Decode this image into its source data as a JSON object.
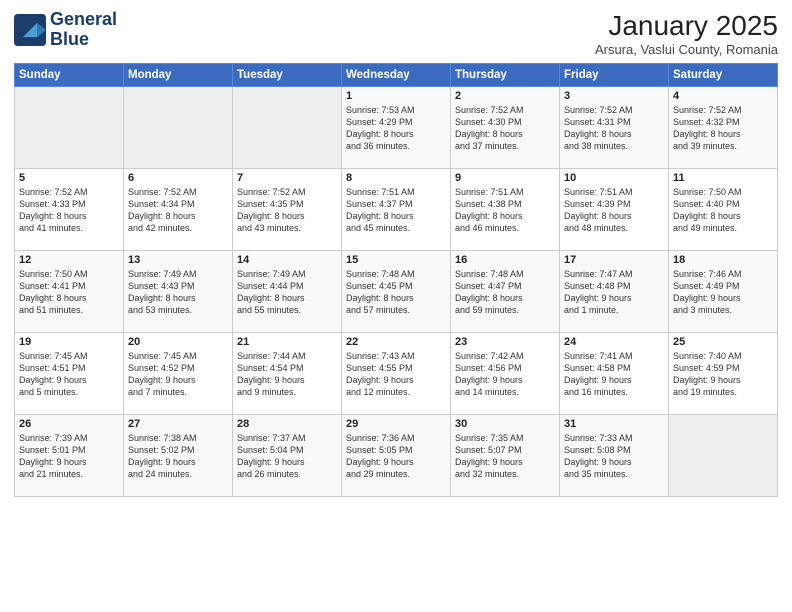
{
  "logo": {
    "line1": "General",
    "line2": "Blue"
  },
  "title": "January 2025",
  "subtitle": "Arsura, Vaslui County, Romania",
  "days_of_week": [
    "Sunday",
    "Monday",
    "Tuesday",
    "Wednesday",
    "Thursday",
    "Friday",
    "Saturday"
  ],
  "weeks": [
    [
      {
        "day": "",
        "info": ""
      },
      {
        "day": "",
        "info": ""
      },
      {
        "day": "",
        "info": ""
      },
      {
        "day": "1",
        "info": "Sunrise: 7:53 AM\nSunset: 4:29 PM\nDaylight: 8 hours\nand 36 minutes."
      },
      {
        "day": "2",
        "info": "Sunrise: 7:52 AM\nSunset: 4:30 PM\nDaylight: 8 hours\nand 37 minutes."
      },
      {
        "day": "3",
        "info": "Sunrise: 7:52 AM\nSunset: 4:31 PM\nDaylight: 8 hours\nand 38 minutes."
      },
      {
        "day": "4",
        "info": "Sunrise: 7:52 AM\nSunset: 4:32 PM\nDaylight: 8 hours\nand 39 minutes."
      }
    ],
    [
      {
        "day": "5",
        "info": "Sunrise: 7:52 AM\nSunset: 4:33 PM\nDaylight: 8 hours\nand 41 minutes."
      },
      {
        "day": "6",
        "info": "Sunrise: 7:52 AM\nSunset: 4:34 PM\nDaylight: 8 hours\nand 42 minutes."
      },
      {
        "day": "7",
        "info": "Sunrise: 7:52 AM\nSunset: 4:35 PM\nDaylight: 8 hours\nand 43 minutes."
      },
      {
        "day": "8",
        "info": "Sunrise: 7:51 AM\nSunset: 4:37 PM\nDaylight: 8 hours\nand 45 minutes."
      },
      {
        "day": "9",
        "info": "Sunrise: 7:51 AM\nSunset: 4:38 PM\nDaylight: 8 hours\nand 46 minutes."
      },
      {
        "day": "10",
        "info": "Sunrise: 7:51 AM\nSunset: 4:39 PM\nDaylight: 8 hours\nand 48 minutes."
      },
      {
        "day": "11",
        "info": "Sunrise: 7:50 AM\nSunset: 4:40 PM\nDaylight: 8 hours\nand 49 minutes."
      }
    ],
    [
      {
        "day": "12",
        "info": "Sunrise: 7:50 AM\nSunset: 4:41 PM\nDaylight: 8 hours\nand 51 minutes."
      },
      {
        "day": "13",
        "info": "Sunrise: 7:49 AM\nSunset: 4:43 PM\nDaylight: 8 hours\nand 53 minutes."
      },
      {
        "day": "14",
        "info": "Sunrise: 7:49 AM\nSunset: 4:44 PM\nDaylight: 8 hours\nand 55 minutes."
      },
      {
        "day": "15",
        "info": "Sunrise: 7:48 AM\nSunset: 4:45 PM\nDaylight: 8 hours\nand 57 minutes."
      },
      {
        "day": "16",
        "info": "Sunrise: 7:48 AM\nSunset: 4:47 PM\nDaylight: 8 hours\nand 59 minutes."
      },
      {
        "day": "17",
        "info": "Sunrise: 7:47 AM\nSunset: 4:48 PM\nDaylight: 9 hours\nand 1 minute."
      },
      {
        "day": "18",
        "info": "Sunrise: 7:46 AM\nSunset: 4:49 PM\nDaylight: 9 hours\nand 3 minutes."
      }
    ],
    [
      {
        "day": "19",
        "info": "Sunrise: 7:45 AM\nSunset: 4:51 PM\nDaylight: 9 hours\nand 5 minutes."
      },
      {
        "day": "20",
        "info": "Sunrise: 7:45 AM\nSunset: 4:52 PM\nDaylight: 9 hours\nand 7 minutes."
      },
      {
        "day": "21",
        "info": "Sunrise: 7:44 AM\nSunset: 4:54 PM\nDaylight: 9 hours\nand 9 minutes."
      },
      {
        "day": "22",
        "info": "Sunrise: 7:43 AM\nSunset: 4:55 PM\nDaylight: 9 hours\nand 12 minutes."
      },
      {
        "day": "23",
        "info": "Sunrise: 7:42 AM\nSunset: 4:56 PM\nDaylight: 9 hours\nand 14 minutes."
      },
      {
        "day": "24",
        "info": "Sunrise: 7:41 AM\nSunset: 4:58 PM\nDaylight: 9 hours\nand 16 minutes."
      },
      {
        "day": "25",
        "info": "Sunrise: 7:40 AM\nSunset: 4:59 PM\nDaylight: 9 hours\nand 19 minutes."
      }
    ],
    [
      {
        "day": "26",
        "info": "Sunrise: 7:39 AM\nSunset: 5:01 PM\nDaylight: 9 hours\nand 21 minutes."
      },
      {
        "day": "27",
        "info": "Sunrise: 7:38 AM\nSunset: 5:02 PM\nDaylight: 9 hours\nand 24 minutes."
      },
      {
        "day": "28",
        "info": "Sunrise: 7:37 AM\nSunset: 5:04 PM\nDaylight: 9 hours\nand 26 minutes."
      },
      {
        "day": "29",
        "info": "Sunrise: 7:36 AM\nSunset: 5:05 PM\nDaylight: 9 hours\nand 29 minutes."
      },
      {
        "day": "30",
        "info": "Sunrise: 7:35 AM\nSunset: 5:07 PM\nDaylight: 9 hours\nand 32 minutes."
      },
      {
        "day": "31",
        "info": "Sunrise: 7:33 AM\nSunset: 5:08 PM\nDaylight: 9 hours\nand 35 minutes."
      },
      {
        "day": "",
        "info": ""
      }
    ]
  ]
}
